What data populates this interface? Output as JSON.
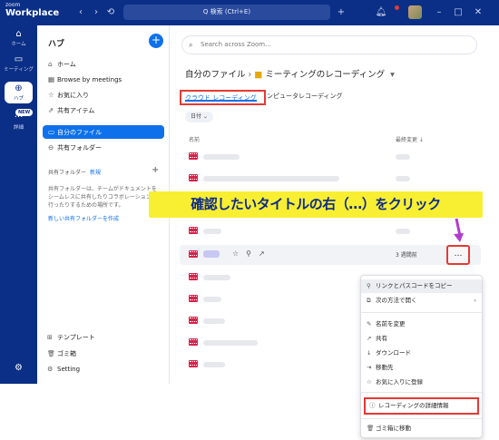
{
  "app": {
    "logo_small": "zoom",
    "logo_big": "Workplace"
  },
  "topbar": {
    "search_label": "Q 検索 (Ctrl+E)",
    "icons": [
      "back-icon",
      "forward-icon",
      "history-icon",
      "plus-icon",
      "bell-icon",
      "apps-icon",
      "minimize-icon",
      "maximize-icon",
      "close-icon"
    ]
  },
  "rail": {
    "items": [
      {
        "label": "ホーム",
        "icon": "home-icon"
      },
      {
        "label": "ミーティング",
        "icon": "video-icon"
      },
      {
        "label": "ハブ",
        "icon": "hub-icon"
      },
      {
        "label": "詳細",
        "icon": "more-icon"
      }
    ],
    "new_badge": "NEW"
  },
  "hub": {
    "title": "ハブ",
    "nav": [
      {
        "label": "ホーム",
        "icon": "home-icon"
      },
      {
        "label": "Browse by meetings",
        "icon": "calendar-icon"
      },
      {
        "label": "お気に入り",
        "icon": "star-icon"
      },
      {
        "label": "共有アイテム",
        "icon": "share-icon"
      },
      {
        "label": "自分のファイル",
        "icon": "folder-icon"
      },
      {
        "label": "共有フォルダー",
        "icon": "shared-folder-icon"
      }
    ],
    "shared_section_label": "共有フォルダー",
    "shared_section_tag": "新規",
    "shared_desc": "共有フォルダーは、チームがドキュメントをシームレスに共有したりコラボレーションを行ったりするための場所です。",
    "shared_link": "新しい共有フォルダーを作成",
    "bottom": [
      {
        "label": "テンプレート",
        "icon": "template-icon"
      },
      {
        "label": "ゴミ箱",
        "icon": "trash-icon"
      },
      {
        "label": "Setting",
        "icon": "gear-icon"
      }
    ]
  },
  "main": {
    "search_placeholder": "Search across Zoom...",
    "breadcrumb_root": "自分のファイル",
    "breadcrumb_current": "ミーティングのレコーディング",
    "tab_active": "クラウド レコーディング",
    "tab_other": "ンピュータレコーディング",
    "filter": "日付 ⌄",
    "col_name": "名前",
    "col_modified": "最終変更 ↓",
    "hover_row_date": "3 週間前",
    "more_label": "…"
  },
  "banner": "確認したいタイトルの右（…）をクリック",
  "context_menu": [
    {
      "label": "リンクとパスコードをコピー",
      "icon": "link-icon"
    },
    {
      "label": "次の方法で開く",
      "icon": "open-icon"
    },
    {
      "label": "名前を変更",
      "icon": "pencil-icon"
    },
    {
      "label": "共有",
      "icon": "share-icon"
    },
    {
      "label": "ダウンロード",
      "icon": "download-icon"
    },
    {
      "label": "移動先",
      "icon": "move-icon"
    },
    {
      "label": "お気に入りに登録",
      "icon": "star-icon"
    },
    {
      "label": "レコーディングの詳細情報",
      "icon": "info-icon"
    },
    {
      "label": "ゴミ箱に移動",
      "icon": "trash-icon"
    }
  ],
  "colors": {
    "brand_navy": "#0b2f86",
    "accent_blue": "#0e71eb",
    "highlight_red": "#e53935",
    "banner_yellow": "#f8ef32",
    "arrow_purple": "#b23ccf",
    "file_red": "#d6234b"
  }
}
